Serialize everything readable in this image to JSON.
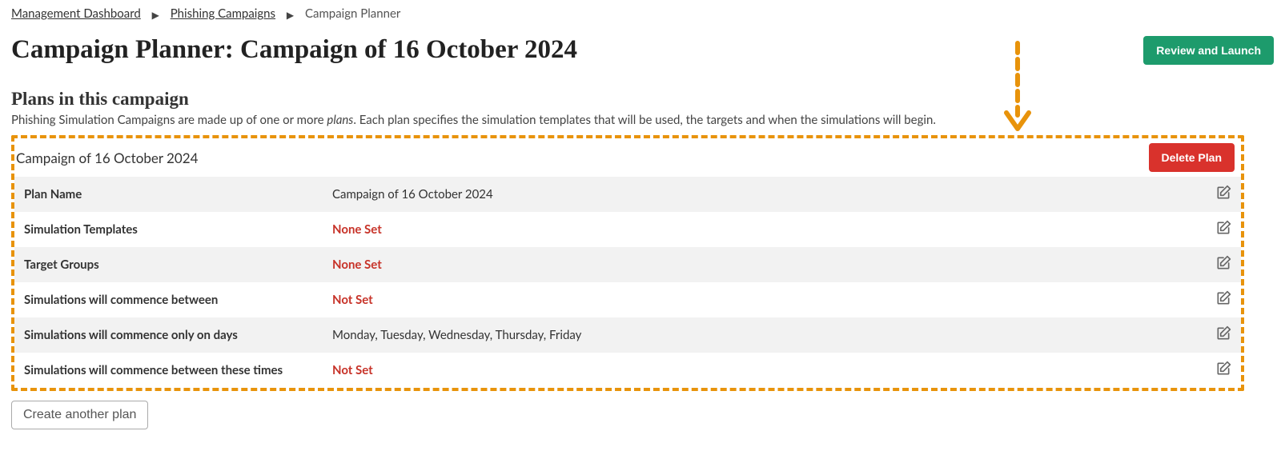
{
  "breadcrumb": {
    "management_dashboard": "Management Dashboard",
    "phishing_campaigns": "Phishing Campaigns",
    "current": "Campaign Planner"
  },
  "page_title": "Campaign Planner: Campaign of 16 October 2024",
  "review_button": "Review and Launch",
  "subtitle": "Plans in this campaign",
  "subtitle_desc_1": "Phishing Simulation Campaigns are made up of one or more ",
  "subtitle_desc_em": "plans",
  "subtitle_desc_2": ". Each plan specifies the simulation templates that will be used, the targets and when the simulations will begin.",
  "plan": {
    "header": "Campaign of 16 October 2024",
    "delete_button": "Delete Plan",
    "rows": {
      "plan_name": {
        "label": "Plan Name",
        "value": "Campaign of 16 October 2024",
        "unset": false
      },
      "sim_templates": {
        "label": "Simulation Templates",
        "value": "None Set",
        "unset": true
      },
      "target_groups": {
        "label": "Target Groups",
        "value": "None Set",
        "unset": true
      },
      "commence_between": {
        "label": "Simulations will commence between",
        "value": "Not Set",
        "unset": true
      },
      "commence_days": {
        "label": "Simulations will commence only on days",
        "value": "Monday, Tuesday, Wednesday, Thursday, Friday",
        "unset": false
      },
      "commence_times": {
        "label": "Simulations will commence between these times",
        "value": "Not Set",
        "unset": true
      }
    }
  },
  "create_another": "Create another plan"
}
